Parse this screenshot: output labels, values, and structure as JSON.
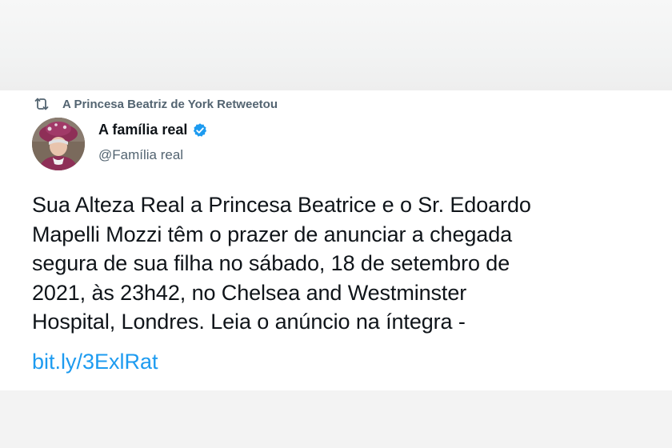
{
  "retweet": {
    "text": "A Princesa Beatriz de York Retweetou",
    "icon": "retweet-icon"
  },
  "author": {
    "display_name": "A família real",
    "handle": "@Família real",
    "verified_icon": "verified-badge-icon",
    "verified_color": "#1d9bf0"
  },
  "tweet": {
    "lines": [
      "Sua Alteza Real a Princesa Beatrice e o Sr. Edoardo",
      "Mapelli Mozzi têm o prazer de anunciar a chegada",
      "segura de sua filha no sábado, 18 de setembro de",
      "2021, às 23h42, no Chelsea and Westminster",
      "Hospital, Londres. Leia o anúncio na íntegra -"
    ],
    "link": "bit.ly/3ExlRat",
    "link_color": "#1d9bf0"
  }
}
